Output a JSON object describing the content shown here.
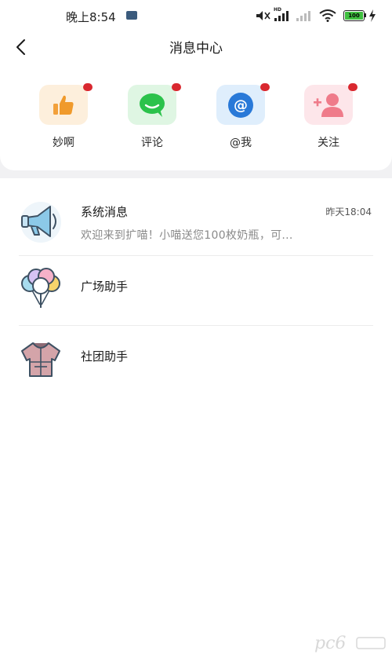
{
  "status_bar": {
    "time": "晚上8:54",
    "network_badge": "HD",
    "battery_level": "100"
  },
  "header": {
    "title": "消息中心"
  },
  "quick_actions": [
    {
      "label": "妙啊",
      "icon": "thumbs-up-icon",
      "color": "#f09a2b",
      "tile_color": "#fdefdc"
    },
    {
      "label": "评论",
      "icon": "comment-bubble-icon",
      "color": "#2bc24b",
      "tile_color": "#dff6e3"
    },
    {
      "label": "@我",
      "icon": "at-sign-icon",
      "color": "#2979d8",
      "tile_color": "#dfeefc"
    },
    {
      "label": "关注",
      "icon": "add-user-icon",
      "color": "#ef7b8a",
      "tile_color": "#fde6ea"
    }
  ],
  "messages": [
    {
      "title": "系统消息",
      "time": "昨天18:04",
      "preview": "欢迎来到扩喵！小喵送您100枚奶瓶，可...",
      "icon": "megaphone-icon"
    },
    {
      "title": "广场助手",
      "icon": "balloons-icon"
    },
    {
      "title": "社团助手",
      "icon": "jacket-icon"
    }
  ],
  "colors": {
    "badge_red": "#d9282f",
    "background": "#f1f1f3"
  }
}
